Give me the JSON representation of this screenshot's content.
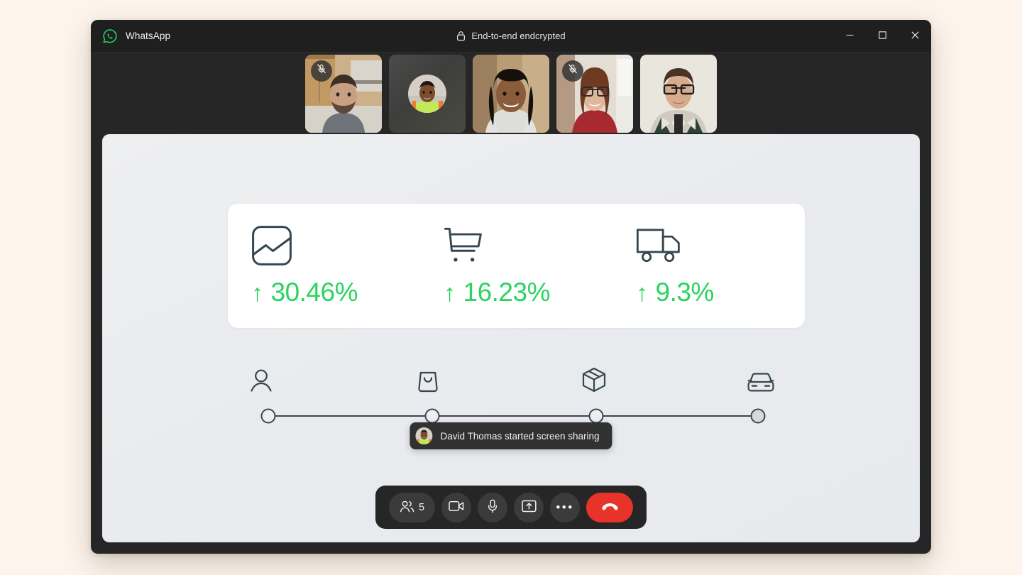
{
  "app": {
    "name": "WhatsApp",
    "logo_icon": "whatsapp-logo-icon",
    "encryption_label": "End-to-end endcrypted",
    "lock_icon": "lock-icon",
    "accent_green": "#25D366",
    "window_bg": "#262626",
    "page_bg": "#FDF4EC"
  },
  "window_controls": {
    "minimize": {
      "icon": "minimize-icon",
      "label": "Minimize"
    },
    "maximize": {
      "icon": "maximize-icon",
      "label": "Maximize"
    },
    "close": {
      "icon": "close-icon",
      "label": "Close"
    }
  },
  "participants": {
    "count": 5,
    "tiles": [
      {
        "id": "participant-1",
        "camera_on": true,
        "muted": true,
        "mute_icon": "mic-off-icon"
      },
      {
        "id": "participant-2",
        "camera_on": false,
        "muted": false,
        "avatar": "avatar-image"
      },
      {
        "id": "participant-3",
        "camera_on": true,
        "muted": false
      },
      {
        "id": "participant-4",
        "camera_on": true,
        "muted": true,
        "mute_icon": "mic-off-icon"
      },
      {
        "id": "participant-5",
        "camera_on": true,
        "muted": false
      }
    ]
  },
  "shared_screen": {
    "stats_card": {
      "stats": [
        {
          "icon": "image-chart-icon",
          "arrow": "↑",
          "value": "30.46%",
          "direction": "up"
        },
        {
          "icon": "shopping-cart-icon",
          "arrow": "↑",
          "value": "16.23%",
          "direction": "up"
        },
        {
          "icon": "delivery-truck-icon",
          "arrow": "↑",
          "value": "9.3%",
          "direction": "up"
        }
      ],
      "value_color": "#2BD35F"
    },
    "stepper": {
      "line_color": "#3C4753",
      "steps": [
        {
          "icon": "person-icon",
          "filled": false
        },
        {
          "icon": "shopping-bag-icon",
          "filled": false
        },
        {
          "icon": "package-box-icon",
          "filled": false
        },
        {
          "icon": "car-icon",
          "filled": true
        }
      ]
    }
  },
  "toast": {
    "avatar": "david-thomas-avatar",
    "message": "David Thomas started screen sharing"
  },
  "controls": {
    "participants": {
      "icon": "people-icon",
      "count": "5",
      "label": "Participants"
    },
    "camera": {
      "icon": "video-camera-icon",
      "label": "Camera"
    },
    "microphone": {
      "icon": "microphone-icon",
      "label": "Microphone"
    },
    "share_screen": {
      "icon": "share-screen-icon",
      "label": "Share screen"
    },
    "more": {
      "icon": "more-horizontal-icon",
      "glyph": "•••",
      "label": "More options"
    },
    "end_call": {
      "icon": "end-call-icon",
      "label": "End call",
      "color": "#E8332A"
    }
  }
}
